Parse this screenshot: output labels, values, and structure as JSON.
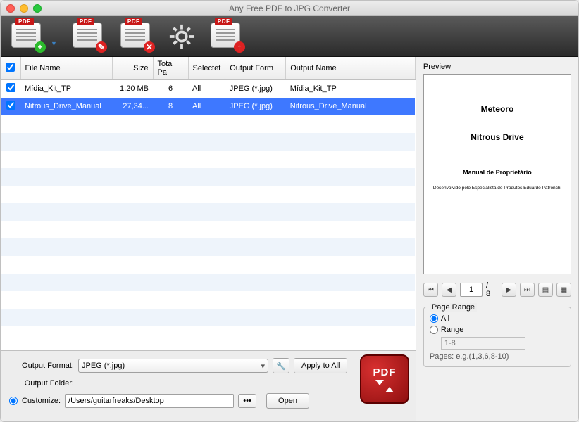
{
  "window": {
    "title": "Any Free PDF to JPG Converter"
  },
  "toolbar": {
    "pdf_badge": "PDF"
  },
  "table": {
    "headers": {
      "file": "File Name",
      "size": "Size",
      "total": "Total Pa",
      "selected": "Selectet",
      "format": "Output Form",
      "outname": "Output Name"
    },
    "rows": [
      {
        "checked": true,
        "file": "Mídia_Kit_TP",
        "size": "1,20 MB",
        "total": "6",
        "selected": "All",
        "format": "JPEG (*.jpg)",
        "outname": "Mídia_Kit_TP",
        "sel": false
      },
      {
        "checked": true,
        "file": "Nitrous_Drive_Manual",
        "size": "27,34...",
        "total": "8",
        "selected": "All",
        "format": "JPEG (*.jpg)",
        "outname": "Nitrous_Drive_Manual",
        "sel": true
      }
    ]
  },
  "output": {
    "format_label": "Output Format:",
    "format_value": "JPEG (*.jpg)",
    "apply_all": "Apply to All",
    "folder_label": "Output Folder:",
    "customize_label": "Customize:",
    "path": "/Users/guitarfreaks/Desktop",
    "open": "Open",
    "big_pdf": "PDF"
  },
  "preview": {
    "label": "Preview",
    "t1": "Meteoro",
    "t2": "Nitrous Drive",
    "t3": "Manual de Proprietário",
    "t4": "Desenvolvido pelo Especialista de Produtos Eduardo Patronchi",
    "page": "1",
    "total": "/ 8"
  },
  "range": {
    "legend": "Page Range",
    "all": "All",
    "range": "Range",
    "placeholder": "1-8",
    "hint": "Pages: e.g.(1,3,6,8-10)"
  }
}
